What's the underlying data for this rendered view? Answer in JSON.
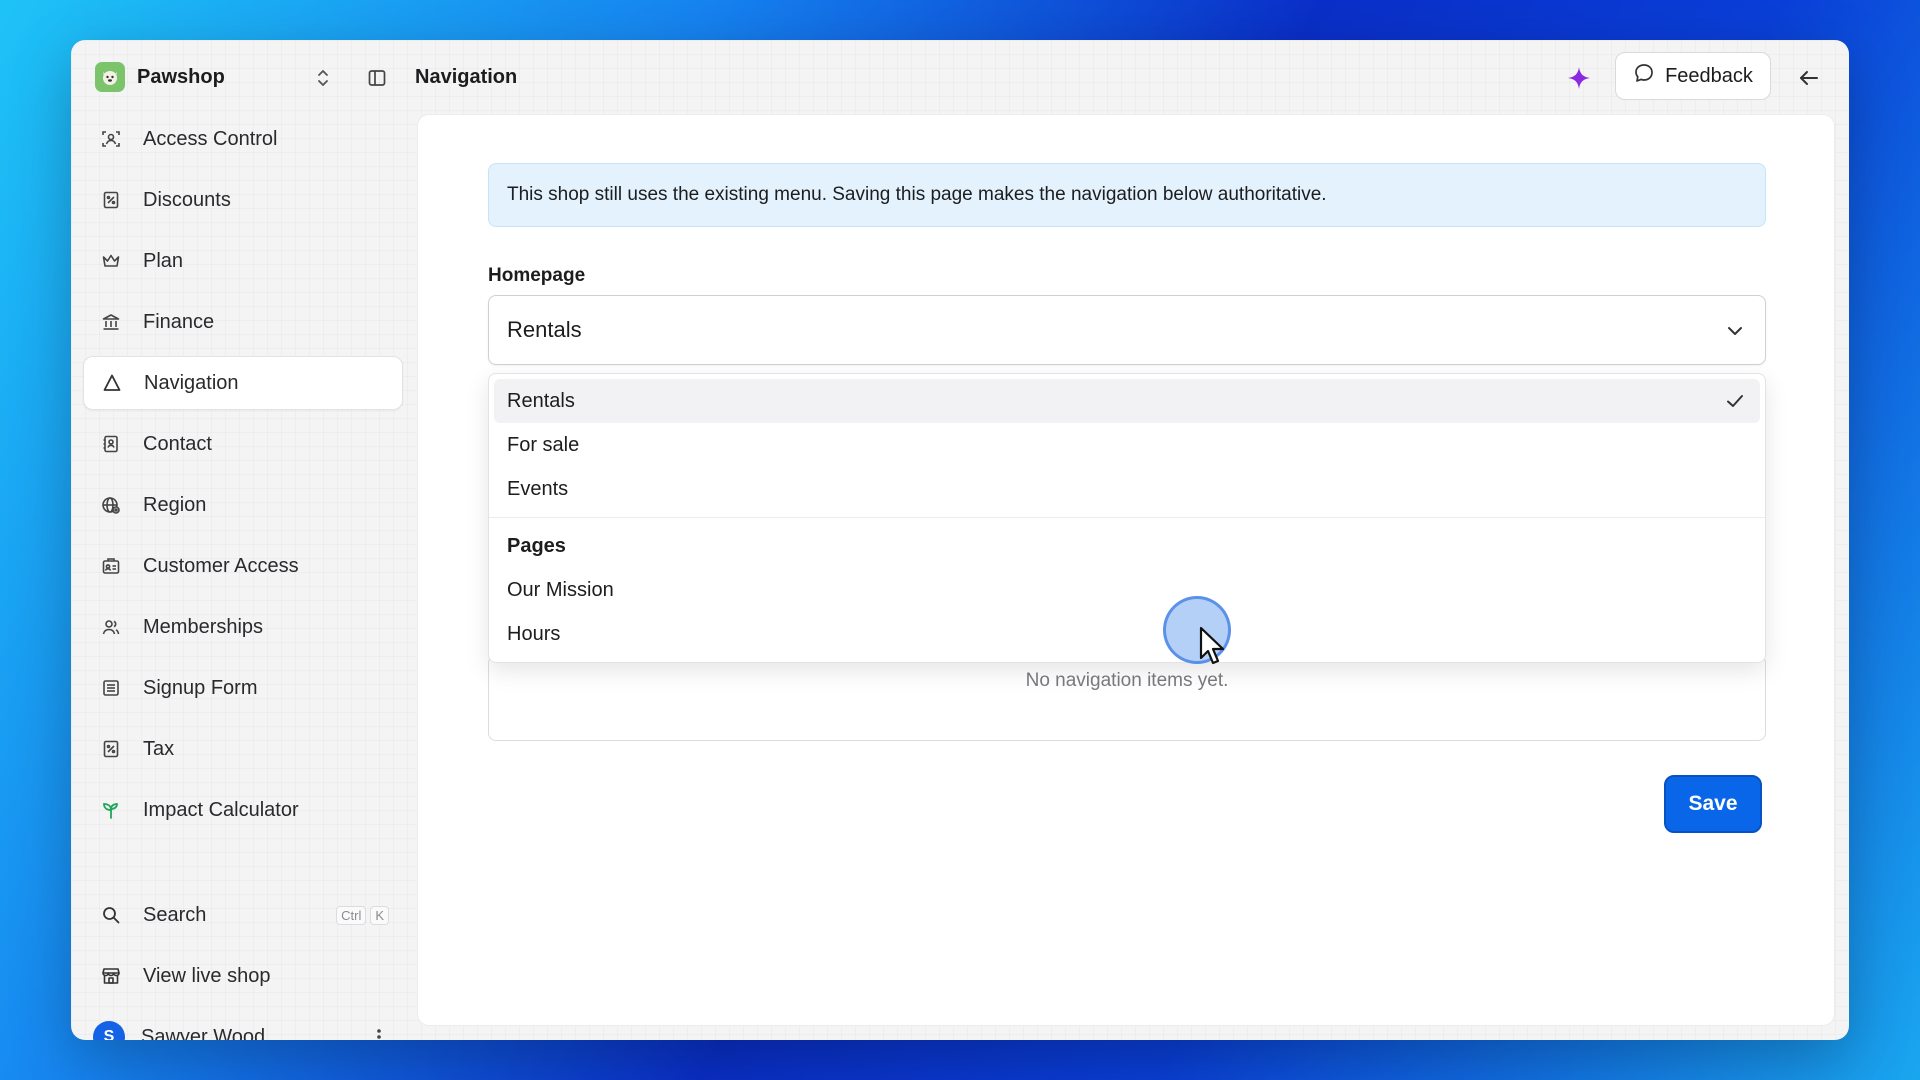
{
  "brand": {
    "name": "Pawshop"
  },
  "header": {
    "title": "Navigation",
    "feedback_label": "Feedback"
  },
  "sidebar": {
    "items": [
      {
        "label": "Access Control",
        "icon": "access-control-icon"
      },
      {
        "label": "Discounts",
        "icon": "discount-icon"
      },
      {
        "label": "Plan",
        "icon": "crown-icon"
      },
      {
        "label": "Finance",
        "icon": "bank-icon"
      },
      {
        "label": "Navigation",
        "icon": "navigation-icon",
        "active": true
      },
      {
        "label": "Contact",
        "icon": "contact-icon"
      },
      {
        "label": "Region",
        "icon": "globe-icon"
      },
      {
        "label": "Customer Access",
        "icon": "customer-access-icon"
      },
      {
        "label": "Memberships",
        "icon": "users-icon"
      },
      {
        "label": "Signup Form",
        "icon": "form-icon"
      },
      {
        "label": "Tax",
        "icon": "tax-icon"
      },
      {
        "label": "Impact Calculator",
        "icon": "sprout-icon"
      }
    ],
    "search": {
      "label": "Search",
      "shortcut": [
        "Ctrl",
        "K"
      ]
    },
    "view_live": {
      "label": "View live shop"
    },
    "user": {
      "initial": "S",
      "name": "Sawyer Wood"
    }
  },
  "main": {
    "banner": "This shop still uses the existing menu. Saving this page makes the navigation below authoritative.",
    "homepage": {
      "label": "Homepage",
      "value": "Rentals",
      "options": [
        "Rentals",
        "For sale",
        "Events"
      ],
      "group_label": "Pages",
      "group_options": [
        "Our Mission",
        "Hours"
      ]
    },
    "empty_text": "No navigation items yet.",
    "save_label": "Save"
  },
  "colors": {
    "accent": "#0a66e8",
    "banner_bg": "#e3f2fc",
    "sparkle": "#8a2be2"
  }
}
